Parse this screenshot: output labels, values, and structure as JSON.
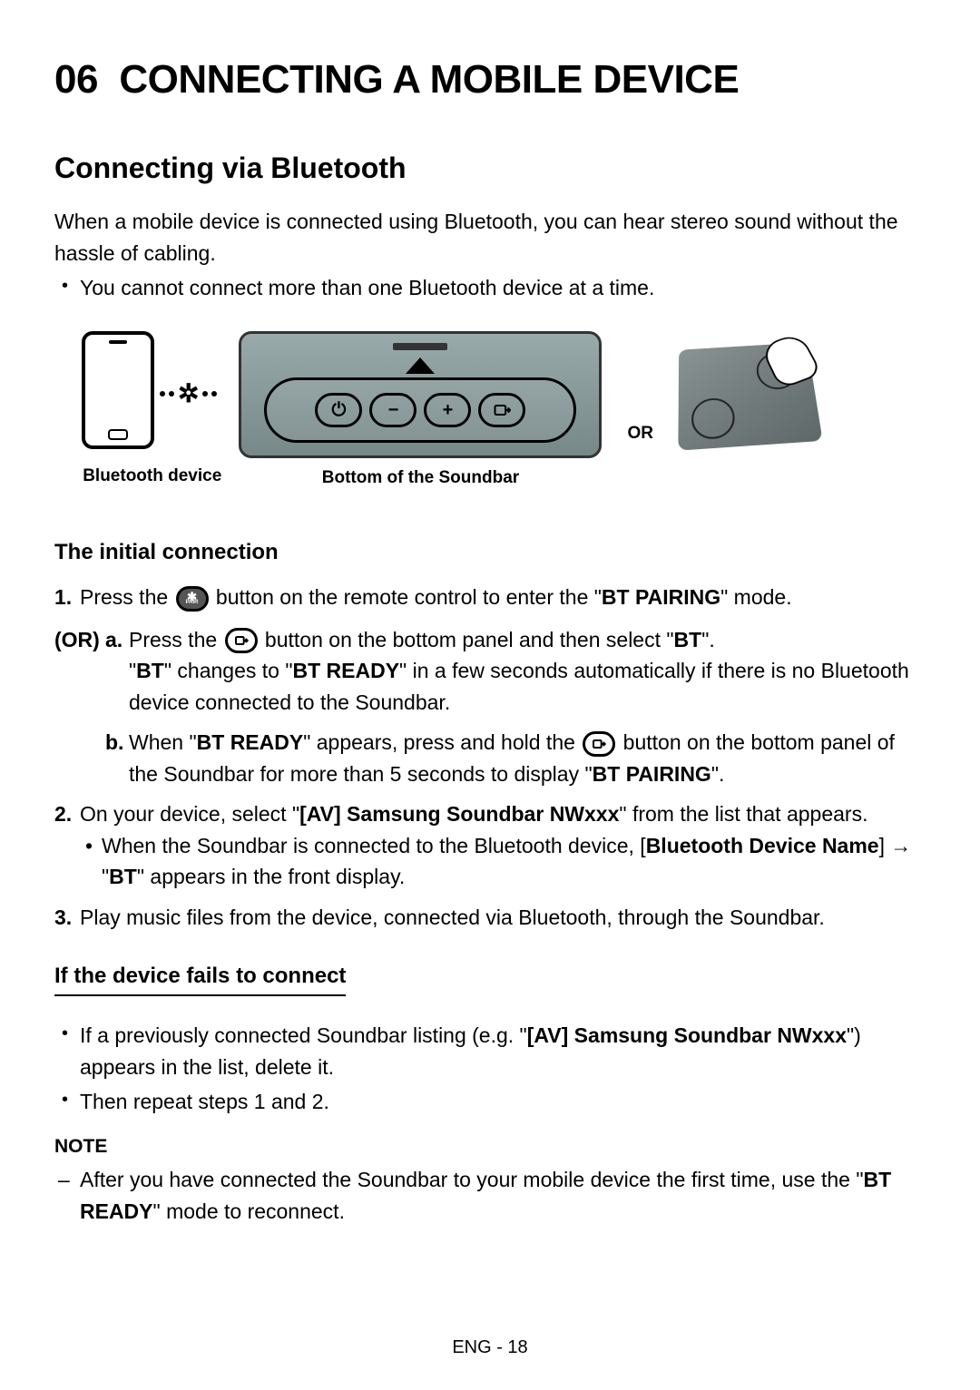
{
  "chapter_number": "06",
  "chapter_title": "CONNECTING A MOBILE DEVICE",
  "section_title": "Connecting via Bluetooth",
  "intro_paragraph": "When a mobile device is connected using Bluetooth, you can hear stereo sound without the hassle of cabling.",
  "intro_bullet": "You cannot connect more than one Bluetooth device at a time.",
  "diagram": {
    "device_caption": "Bluetooth device",
    "soundbar_caption": "Bottom of the Soundbar",
    "or_label": "OR"
  },
  "subheading_initial": "The initial connection",
  "step1": {
    "num": "1.",
    "pre": "Press the ",
    "post": " button on the remote control to enter the \"",
    "mode": "BT PAIRING",
    "tail": "\" mode."
  },
  "or_label": "(OR)",
  "step_a": {
    "num": "a.",
    "pre": "Press the ",
    "mid": " button on the bottom panel and then select \"",
    "bt": "BT",
    "tail": "\".",
    "line2_pre": "\"",
    "line2_bt": "BT",
    "line2_mid": "\" changes to \"",
    "line2_ready": "BT READY",
    "line2_post": "\" in a few seconds automatically if there is no Bluetooth device connected to the Soundbar."
  },
  "step_b": {
    "num": "b.",
    "pre": "When \"",
    "ready": "BT READY",
    "mid": "\" appears, press and hold the ",
    "post": " button on the bottom panel of the Soundbar for more than 5 seconds to display \"",
    "pairing": "BT PAIRING",
    "tail": "\"."
  },
  "step2": {
    "num": "2.",
    "pre": "On your device, select \"",
    "device_name": "[AV] Samsung Soundbar NWxxx",
    "post": "\" from the list that appears.",
    "bullet_pre": "When the Soundbar is connected to the Bluetooth device, [",
    "bullet_name": "Bluetooth Device Name",
    "bullet_mid": "] → \"",
    "bullet_bt": "BT",
    "bullet_post": "\" appears in the front display."
  },
  "step3": {
    "num": "3.",
    "text": "Play music files from the device, connected via Bluetooth, through the Soundbar."
  },
  "subheading_fail": "If the device fails to connect",
  "fail_bullet1_pre": "If a previously connected Soundbar listing (e.g. \"",
  "fail_bullet1_name": "[AV] Samsung Soundbar NWxxx",
  "fail_bullet1_post": "\") appears in the list, delete it.",
  "fail_bullet2": "Then repeat steps 1 and 2.",
  "note_label": "NOTE",
  "note_text_pre": "After you have connected the Soundbar to your mobile device the first time, use the \"",
  "note_ready": "BT READY",
  "note_text_post": "\" mode to reconnect.",
  "page_number": "ENG - 18"
}
